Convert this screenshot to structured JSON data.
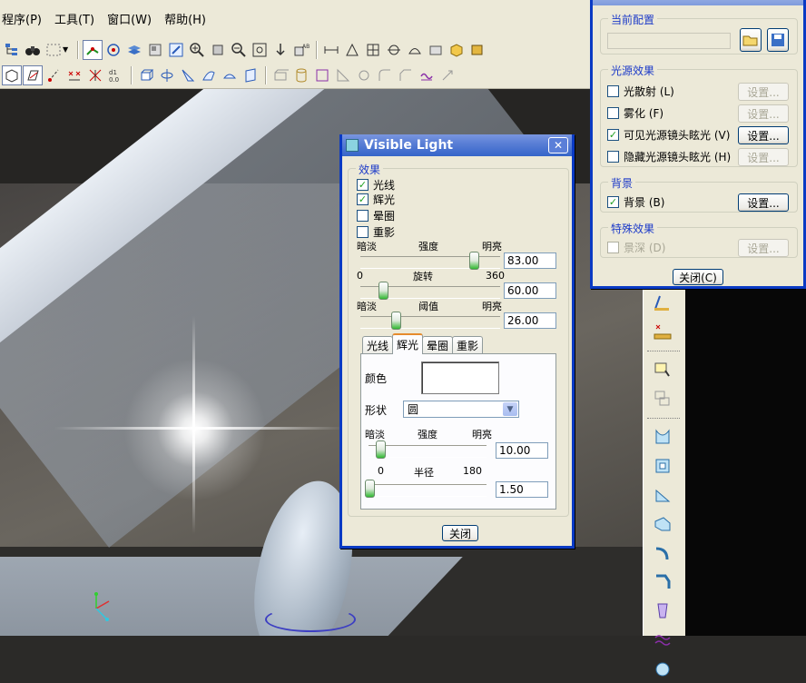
{
  "menu": [
    {
      "label": "程序(P)"
    },
    {
      "label": "工具(T)"
    },
    {
      "label": "窗口(W)"
    },
    {
      "label": "帮助(H)"
    }
  ],
  "visible_light": {
    "title": "Visible Light",
    "effects_group": "效果",
    "checks": [
      {
        "label": "光线",
        "checked": true
      },
      {
        "label": "辉光",
        "checked": true
      },
      {
        "label": "晕圈",
        "checked": false
      },
      {
        "label": "重影",
        "checked": false
      }
    ],
    "intensity": {
      "left": "暗淡",
      "center": "强度",
      "right": "明亮",
      "value": "83.00",
      "fraction": 0.83
    },
    "rotation": {
      "min": "0",
      "center": "旋转",
      "max": "360",
      "value": "60.00",
      "fraction": 0.167
    },
    "threshold": {
      "left": "暗淡",
      "center": "阈值",
      "right": "明亮",
      "value": "26.00",
      "fraction": 0.26
    },
    "tabs": [
      {
        "label": "光线",
        "active": false
      },
      {
        "label": "辉光",
        "active": true
      },
      {
        "label": "晕圈",
        "active": false
      },
      {
        "label": "重影",
        "active": false
      }
    ],
    "glow": {
      "color_label": "颜色",
      "color_value": "#ffffff",
      "shape_label": "形状",
      "shape_value": "圆",
      "intensity": {
        "left": "暗淡",
        "center": "强度",
        "right": "明亮",
        "value": "10.00",
        "fraction": 0.1
      },
      "radius": {
        "min": "0",
        "center": "半径",
        "max": "180",
        "value": "1.50",
        "fraction": 0.008
      }
    },
    "close_label": "关闭"
  },
  "effects_editor": {
    "current_config_group": "当前配置",
    "config_value": "",
    "light_effects_group": "光源效果",
    "rows": [
      {
        "label": "光散射 (L)",
        "checked": false,
        "button": "设置...",
        "enabled": false
      },
      {
        "label": "雾化 (F)",
        "checked": false,
        "button": "设置...",
        "enabled": false
      },
      {
        "label": "可见光源镜头眩光 (V)",
        "checked": true,
        "button": "设置...",
        "enabled": true
      },
      {
        "label": "隐藏光源镜头眩光 (H)",
        "checked": false,
        "button": "设置...",
        "enabled": false
      }
    ],
    "background_group": "背景",
    "background_row": {
      "label": "背景 (B)",
      "checked": true,
      "button": "设置...",
      "enabled": true
    },
    "special_group": "特殊效果",
    "special_row": {
      "label": "景深 (D)",
      "checked": false,
      "button": "设置...",
      "enabled": false
    },
    "close_label": "关闭(C)"
  },
  "colors": {
    "titlebar_active": "#3565c9",
    "group_title": "#1c3ac8",
    "window_bg": "#ece9d8",
    "check_mark": "#21a121",
    "slider_thumb": "#31b931"
  }
}
